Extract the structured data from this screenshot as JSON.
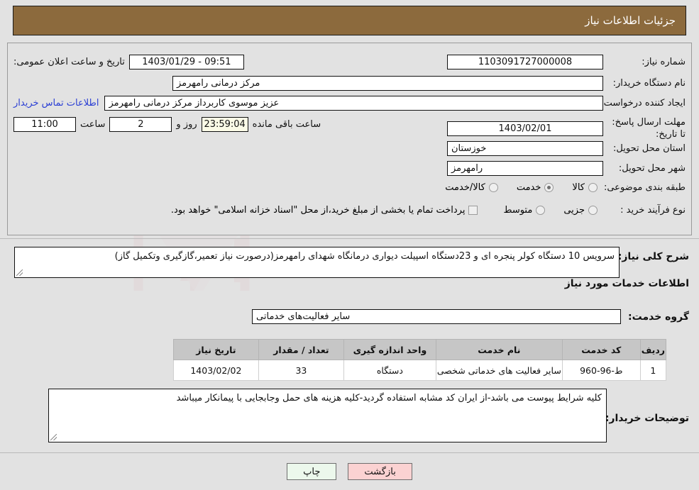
{
  "header": {
    "title": "جزئیات اطلاعات نیاز"
  },
  "form": {
    "need_number_label": "شماره نیاز:",
    "need_number_value": "1103091727000008",
    "announce_label": "تاریخ و ساعت اعلان عمومی:",
    "announce_value": "09:51 - 1403/01/29",
    "buyer_org_label": "نام دستگاه خریدار:",
    "buyer_org_value": "مرکز درمانی رامهرمز",
    "creator_label": "ایجاد کننده درخواست:",
    "creator_value": "عزیز موسوی کاربرداز مرکز درمانی رامهرمز",
    "contact_link": "اطلاعات تماس خریدار",
    "deadline_label": "مهلت ارسال پاسخ: تا تاریخ:",
    "deadline_date": "1403/02/01",
    "hour_label": "ساعت",
    "hour_value": "11:00",
    "days_value": "2",
    "days_label": "روز و",
    "remaining_value": "23:59:04",
    "remaining_label": "ساعت باقی مانده",
    "province_label": "استان محل تحویل:",
    "province_value": "خوزستان",
    "city_label": "شهر محل تحویل:",
    "city_value": "رامهرمز",
    "category_label": "طبقه بندی موضوعی:",
    "category_options": [
      {
        "label": "کالا",
        "selected": false
      },
      {
        "label": "خدمت",
        "selected": true
      },
      {
        "label": "کالا/خدمت",
        "selected": false
      }
    ],
    "process_label": "نوع فرآیند خرید :",
    "process_options": [
      {
        "label": "جزیی",
        "selected": false
      },
      {
        "label": "متوسط",
        "selected": false
      }
    ],
    "treasury_checkbox_label": "پرداخت تمام یا بخشی از مبلغ خرید،از محل \"اسناد خزانه اسلامی\" خواهد بود.",
    "treasury_checked": false
  },
  "description": {
    "label": "شرح کلی نیاز:",
    "value": "سرویس 10 دستگاه کولر پنجره ای و 23دستگاه اسپیلت دیواری درمانگاه شهدای رامهرمز(درصورت نیاز تعمیر،گازگیری وتکمیل گاز)"
  },
  "services": {
    "section_title": "اطلاعات خدمات مورد نیاز",
    "group_label": "گروه خدمت:",
    "group_value": "سایر فعالیت‌های خدماتی",
    "columns": [
      "ردیف",
      "کد خدمت",
      "نام خدمت",
      "واحد اندازه گیری",
      "تعداد / مقدار",
      "تاریخ نیاز"
    ],
    "rows": [
      {
        "index": "1",
        "code": "ط-96-960",
        "name": "سایر فعالیت های خدماتی شخصی",
        "unit": "دستگاه",
        "quantity": "33",
        "date": "1403/02/02"
      }
    ]
  },
  "buyer_notes": {
    "label": "توضیحات خریدار:",
    "value": "کلیه شرایط پیوست می باشد-از ایران کد مشابه استفاده گردید-کلیه هزینه های حمل وجابجایی با پیمانکار میباشد"
  },
  "footer": {
    "print_label": "چاپ",
    "back_label": "بازگشت"
  },
  "watermark": {
    "text": "AnaTender.net"
  },
  "colors": {
    "header_brown": "#8c6a3d",
    "page_bg": "#e2e2e2",
    "link_blue": "#2b3fd4",
    "print_green": "#ecf8ec",
    "back_pink": "#fbd2d2"
  }
}
